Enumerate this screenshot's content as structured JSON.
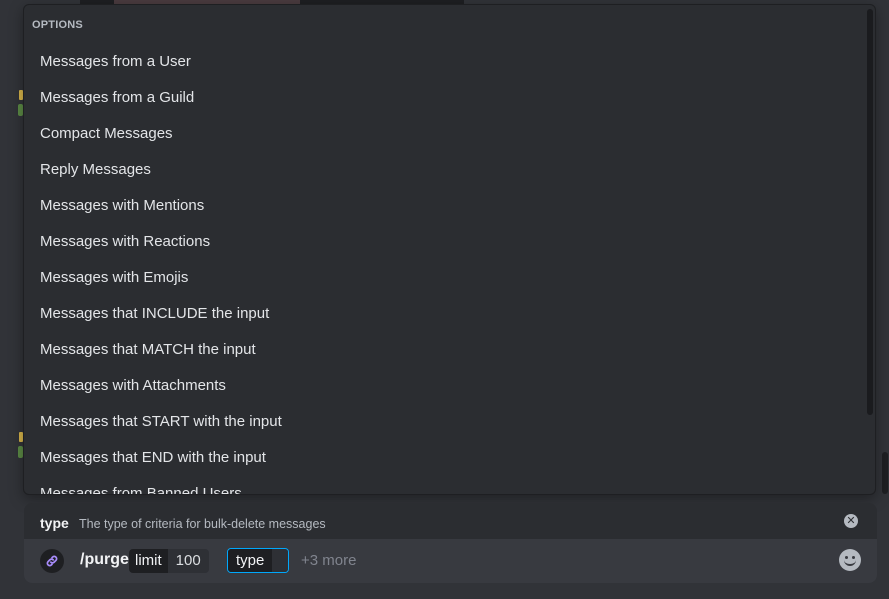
{
  "popup": {
    "header": "OPTIONS",
    "options": [
      "Messages from a User",
      "Messages from a Guild",
      "Compact Messages",
      "Reply Messages",
      "Messages with Mentions",
      "Messages with Reactions",
      "Messages with Emojis",
      "Messages that INCLUDE the input",
      "Messages that MATCH the input",
      "Messages with Attachments",
      "Messages that START with the input",
      "Messages that END with the input",
      "Messages from Banned Users"
    ]
  },
  "command": {
    "option_name": "type",
    "option_description": "The type of criteria for bulk-delete messages",
    "name": "/purge",
    "params": [
      {
        "key": "limit",
        "value": "100"
      },
      {
        "key": "type",
        "value": ""
      }
    ],
    "more": "+3 more"
  },
  "icons": {
    "app": "link-icon",
    "close": "close-circle-icon",
    "emoji": "smiley-icon"
  },
  "colors": {
    "focus_border": "#00a8fc",
    "popup_bg": "#2b2d31",
    "input_bg": "#383a40"
  }
}
